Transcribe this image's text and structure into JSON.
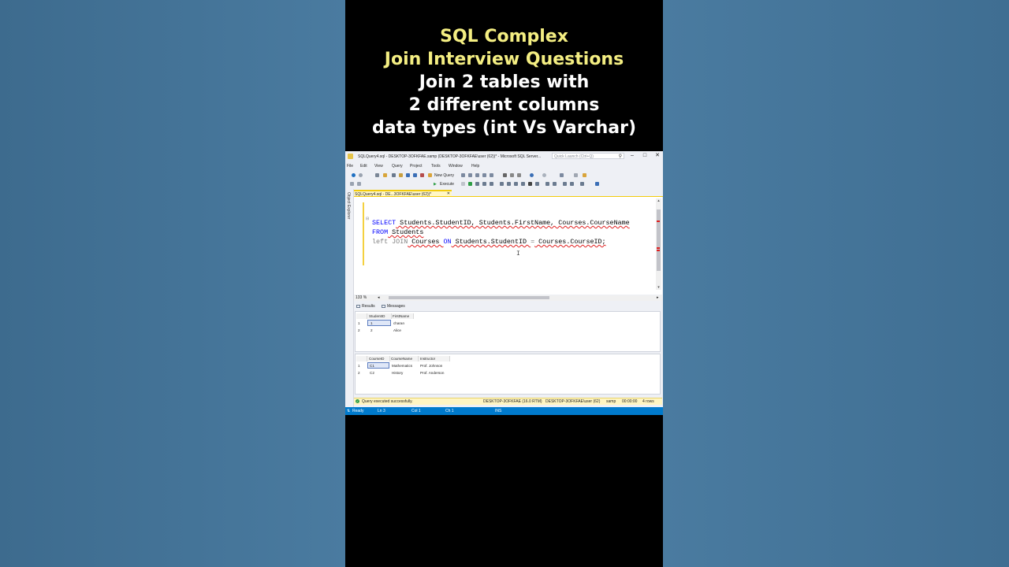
{
  "headline": {
    "line1": "SQL Complex",
    "line2": "Join Interview Questions",
    "line3": "Join 2 tables with",
    "line4": "2 different columns",
    "line5": "data types (int Vs Varchar)"
  },
  "window": {
    "title": "SQLQuery4.sql - DESKTOP-3OFKFAE.samp (DESKTOP-3OFKFAE\\user (62))* - Microsoft SQL Server...",
    "quick_launch_placeholder": "Quick Launch (Ctrl+Q)",
    "controls": {
      "minimize": "–",
      "maximize": "□",
      "close": "✕"
    }
  },
  "menu": [
    "File",
    "Edit",
    "View",
    "Query",
    "Project",
    "Tools",
    "Window",
    "Help"
  ],
  "toolbar": {
    "new_query": "New Query",
    "execute": "Execute",
    "database": "samp"
  },
  "object_explorer_label": "Object Explorer",
  "document_tab": {
    "label": "SQLQuery4.sql - DE...3OFKFAE\\user (62))*",
    "pin": "⊕",
    "close": "✕"
  },
  "editor": {
    "line1": {
      "kw1": "SELECT",
      "t1": " Students.StudentID, Students.FirstName, Courses.CourseName"
    },
    "line2": {
      "kw": "FROM",
      "t": " Students"
    },
    "line3": {
      "kw1": "left",
      "sp1": " ",
      "kw2": "JOIN",
      "t1": " Courses ",
      "kw3": "ON",
      "t2": " Students.StudentID ",
      "op": "=",
      "t3": " Courses.CourseID;"
    },
    "cursor": "I"
  },
  "zoom": "133 %",
  "results_tabs": {
    "results": "Results",
    "messages": "Messages"
  },
  "grid1": {
    "columns": [
      "StudentID",
      "FirstName"
    ],
    "rows": [
      {
        "n": "1",
        "c1": "1",
        "c2": "charan"
      },
      {
        "n": "2",
        "c1": "2",
        "c2": "Alice"
      }
    ]
  },
  "grid2": {
    "columns": [
      "CourseID",
      "CourseName",
      "Instructor"
    ],
    "rows": [
      {
        "n": "1",
        "c1": "C1",
        "c2": "Mathematics",
        "c3": "Prof. Johnson"
      },
      {
        "n": "2",
        "c1": "C2",
        "c2": "History",
        "c3": "Prof. Anderson"
      }
    ]
  },
  "statusbar": {
    "message": "Query executed successfully.",
    "server": "DESKTOP-3OFKFAE (16.0 RTM)",
    "user": "DESKTOP-3OFKFAE\\user (62)",
    "db": "samp",
    "time": "00:00:00",
    "rows": "4 rows"
  },
  "bottombar": {
    "ready": "Ready",
    "ln": "Ln 3",
    "col": "Col 1",
    "ch": "Ch 1",
    "ins": "INS"
  },
  "colors": {
    "accent_yellow": "#f2cc0c",
    "status_blue": "#007acc",
    "keyword": "#0000ff",
    "headline_yellow": "#f4ee82"
  }
}
